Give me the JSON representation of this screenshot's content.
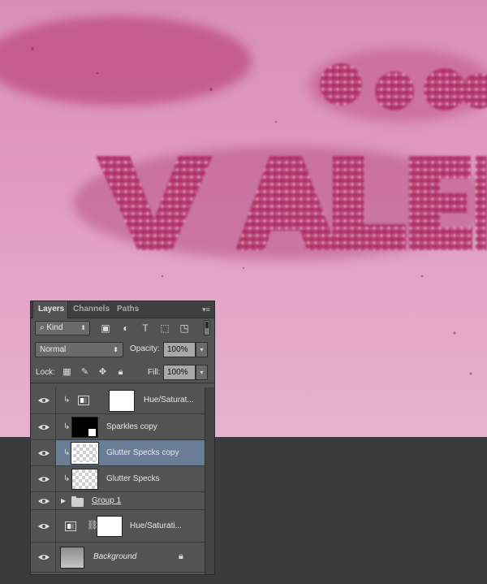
{
  "panel": {
    "tabs": [
      {
        "label": "Layers",
        "active": true
      },
      {
        "label": "Channels",
        "active": false
      },
      {
        "label": "Paths",
        "active": false
      }
    ],
    "filter": {
      "kind_label": "Kind"
    },
    "blend_mode": "Normal",
    "opacity_label": "Opacity:",
    "opacity_value": "100%",
    "lock_label": "Lock:",
    "fill_label": "Fill:",
    "fill_value": "100%",
    "icons": [
      "image-filter-icon",
      "adjustment-filter-icon",
      "type-filter-icon",
      "shape-filter-icon",
      "smart-object-filter-icon",
      "menu-icon",
      "lock-transparent-icon",
      "lock-paint-icon",
      "lock-move-icon",
      "lock-all-icon",
      "eye-icon",
      "chain-icon",
      "folder-icon",
      "padlock-icon"
    ]
  },
  "layers": [
    {
      "name": "Hue/Saturat...",
      "type": "adjustment",
      "clipped": true,
      "selected": false
    },
    {
      "name": "Sparkles copy",
      "type": "smart-object",
      "clipped": true,
      "selected": false
    },
    {
      "name": "Glutter Specks copy",
      "type": "pixel",
      "clipped": true,
      "selected": true
    },
    {
      "name": "Glutter Specks",
      "type": "pixel",
      "clipped": true,
      "selected": false
    },
    {
      "name": "Group 1",
      "type": "group",
      "clipped": false,
      "selected": false
    },
    {
      "name": "Hue/Saturati...",
      "type": "adjustment",
      "clipped": false,
      "selected": false
    },
    {
      "name": "Background",
      "type": "background",
      "clipped": false,
      "selected": false
    }
  ],
  "artwork": {
    "colors": {
      "canvas_top": "#d98fb5",
      "canvas_bottom": "#e7b3cd",
      "glitter": "#b8346f"
    }
  }
}
